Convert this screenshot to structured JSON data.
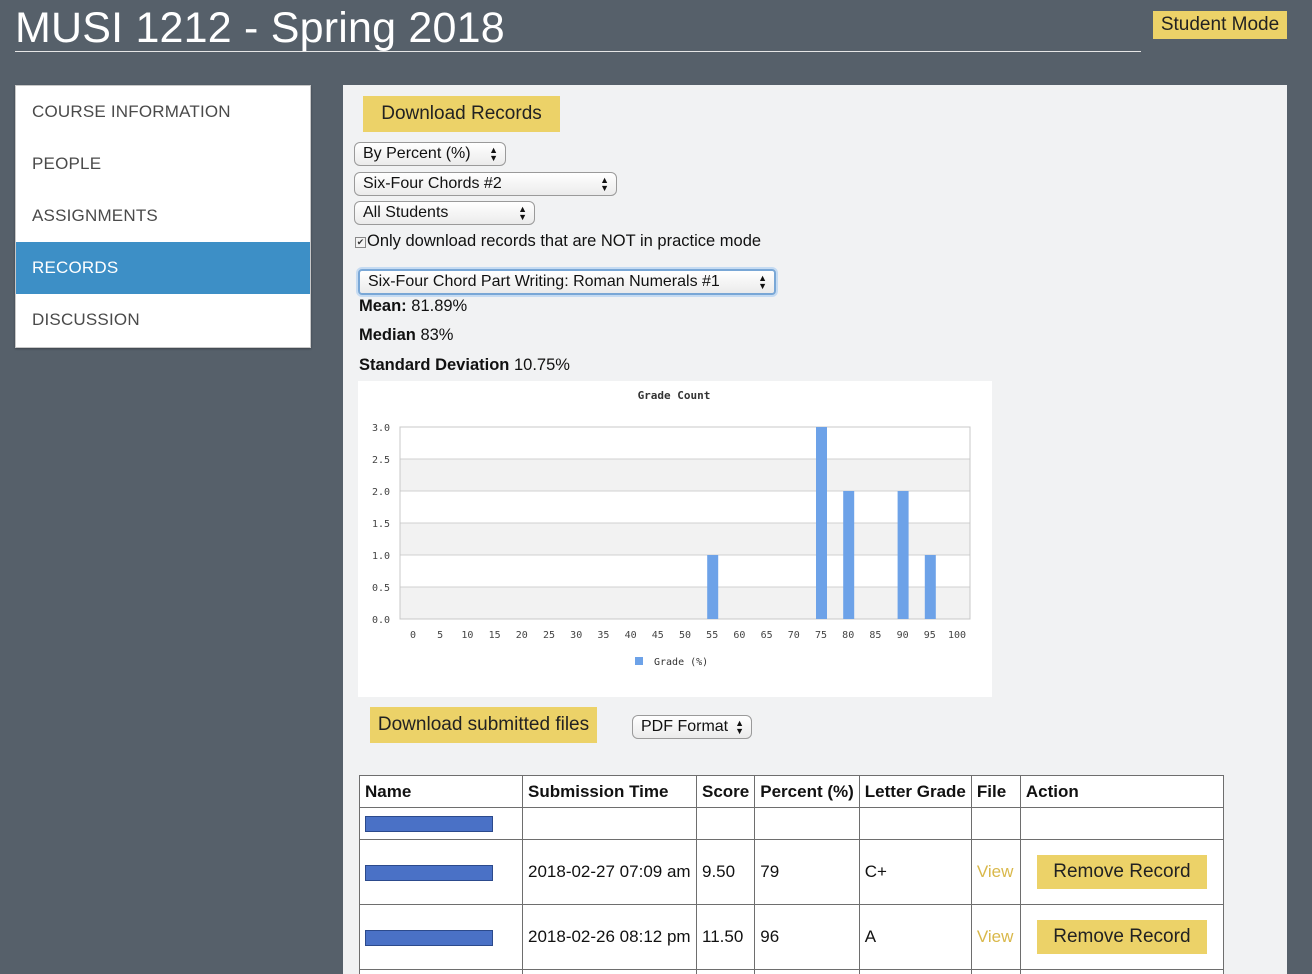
{
  "header": {
    "title": "MUSI 1212 - Spring 2018",
    "mode_button": "Student Mode"
  },
  "sidebar": {
    "items": [
      {
        "label": "COURSE INFORMATION",
        "active": false
      },
      {
        "label": "PEOPLE",
        "active": false
      },
      {
        "label": "ASSIGNMENTS",
        "active": false
      },
      {
        "label": "RECORDS",
        "active": true
      },
      {
        "label": "DISCUSSION",
        "active": false
      }
    ]
  },
  "controls": {
    "download_records": "Download Records",
    "grade_type": "By Percent (%)",
    "assignment_group": "Six-Four Chords #2",
    "student_filter": "All Students",
    "practice_checkbox_label": "Only download records that are NOT in practice mode",
    "practice_checkbox_checked": true,
    "assignment": "Six-Four Chord Part Writing: Roman Numerals #1",
    "download_files": "Download submitted files",
    "file_format": "PDF Format"
  },
  "stats": {
    "mean_label": "Mean:",
    "mean_value": "81.89%",
    "median_label": "Median",
    "median_value": "83%",
    "stddev_label": "Standard Deviation",
    "stddev_value": "10.75%"
  },
  "chart_data": {
    "type": "bar",
    "title": "Grade Count",
    "xlabel": "",
    "ylabel": "",
    "categories": [
      "0",
      "5",
      "10",
      "15",
      "20",
      "25",
      "30",
      "35",
      "40",
      "45",
      "50",
      "55",
      "60",
      "65",
      "70",
      "75",
      "80",
      "85",
      "90",
      "95",
      "100"
    ],
    "series": [
      {
        "name": "Grade (%)",
        "values": [
          0,
          0,
          0,
          0,
          0,
          0,
          0,
          0,
          0,
          0,
          0,
          1,
          0,
          0,
          0,
          3,
          2,
          0,
          2,
          1,
          0
        ]
      }
    ],
    "y_ticks": [
      "0.0",
      "0.5",
      "1.0",
      "1.5",
      "2.0",
      "2.5",
      "3.0"
    ],
    "ylim": [
      0,
      3
    ],
    "grid": true,
    "legend": "bottom",
    "bar_color": "#6da2e8"
  },
  "table": {
    "headers": [
      "Name",
      "Submission Time",
      "Score",
      "Percent (%)",
      "Letter Grade",
      "File",
      "Action"
    ],
    "rows": [
      {
        "submission_time": "",
        "score": "",
        "percent": "",
        "letter_grade": "",
        "file": "",
        "action": ""
      },
      {
        "submission_time": "2018-02-27 07:09 am",
        "score": "9.50",
        "percent": "79",
        "letter_grade": "C+",
        "file": "View",
        "action": "Remove Record"
      },
      {
        "submission_time": "2018-02-26 08:12 pm",
        "score": "11.50",
        "percent": "96",
        "letter_grade": "A",
        "file": "View",
        "action": "Remove Record"
      }
    ]
  },
  "colors": {
    "background": "#56606a",
    "accent": "#ecd268",
    "active_nav": "#3d8fc6",
    "link": "#d9b84a",
    "redaction": "#4a71c6"
  }
}
